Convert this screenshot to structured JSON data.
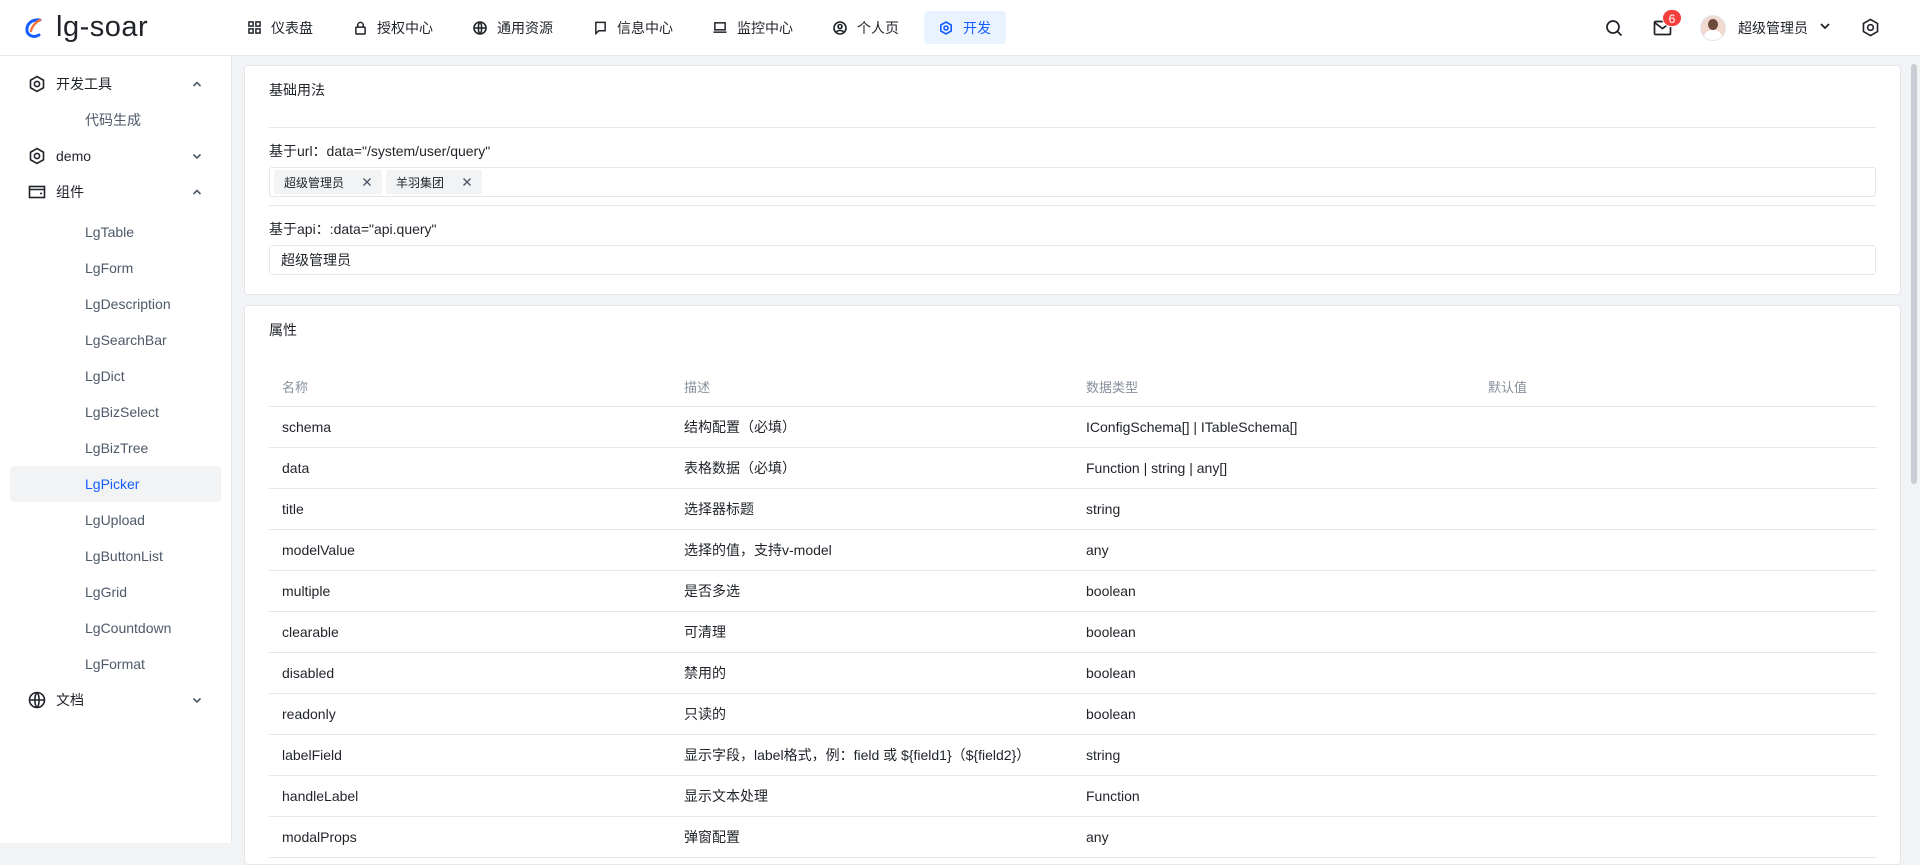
{
  "app": {
    "logo_text": "lg-soar",
    "brand_color": "#165dff"
  },
  "nav": [
    {
      "label": "仪表盘",
      "icon": "dashboard-icon",
      "active": false
    },
    {
      "label": "授权中心",
      "icon": "lock-icon",
      "active": false
    },
    {
      "label": "通用资源",
      "icon": "globe-icon",
      "active": false
    },
    {
      "label": "信息中心",
      "icon": "message-icon",
      "active": false
    },
    {
      "label": "监控中心",
      "icon": "monitor-icon",
      "active": false
    },
    {
      "label": "个人页",
      "icon": "user-circle-icon",
      "active": false
    },
    {
      "label": "开发",
      "icon": "settings-icon",
      "active": true
    }
  ],
  "header": {
    "notification_count": "6",
    "user_name": "超级管理员"
  },
  "sidebar": {
    "groups": [
      {
        "label": "开发工具",
        "icon": "settings-icon",
        "expanded": true,
        "items": [
          {
            "label": "代码生成"
          }
        ]
      },
      {
        "label": "demo",
        "icon": "settings-icon",
        "expanded": false,
        "items": []
      },
      {
        "label": "组件",
        "icon": "wallet-icon",
        "expanded": true,
        "items": [
          {
            "label": "LgTable"
          },
          {
            "label": "LgForm"
          },
          {
            "label": "LgDescription"
          },
          {
            "label": "LgSearchBar"
          },
          {
            "label": "LgDict"
          },
          {
            "label": "LgBizSelect"
          },
          {
            "label": "LgBizTree"
          },
          {
            "label": "LgPicker",
            "active": true
          },
          {
            "label": "LgUpload"
          },
          {
            "label": "LgButtonList"
          },
          {
            "label": "LgGrid"
          },
          {
            "label": "LgCountdown"
          },
          {
            "label": "LgFormat"
          }
        ]
      },
      {
        "label": "文档",
        "icon": "globe-icon",
        "expanded": false,
        "items": []
      }
    ]
  },
  "basic": {
    "title": "基础用法",
    "url_label": "基于url：data=\"/system/user/query\"",
    "url_tags": [
      "超级管理员",
      "羊羽集团"
    ],
    "api_label": "基于api：:data=\"api.query\"",
    "api_value": "超级管理员"
  },
  "props": {
    "title": "属性",
    "headers": [
      "名称",
      "描述",
      "数据类型",
      "默认值"
    ],
    "rows": [
      [
        "schema",
        "结构配置（必填）",
        "IConfigSchema[] | ITableSchema[]",
        ""
      ],
      [
        "data",
        "表格数据（必填）",
        "Function | string | any[]",
        ""
      ],
      [
        "title",
        "选择器标题",
        "string",
        ""
      ],
      [
        "modelValue",
        "选择的值，支持v-model",
        "any",
        ""
      ],
      [
        "multiple",
        "是否多选",
        "boolean",
        ""
      ],
      [
        "clearable",
        "可清理",
        "boolean",
        ""
      ],
      [
        "disabled",
        "禁用的",
        "boolean",
        ""
      ],
      [
        "readonly",
        "只读的",
        "boolean",
        ""
      ],
      [
        "labelField",
        "显示字段，label格式，例：field 或 ${field1}（${field2}）",
        "string",
        ""
      ],
      [
        "handleLabel",
        "显示文本处理",
        "Function",
        ""
      ],
      [
        "modalProps",
        "弹窗配置",
        "any",
        ""
      ]
    ]
  }
}
